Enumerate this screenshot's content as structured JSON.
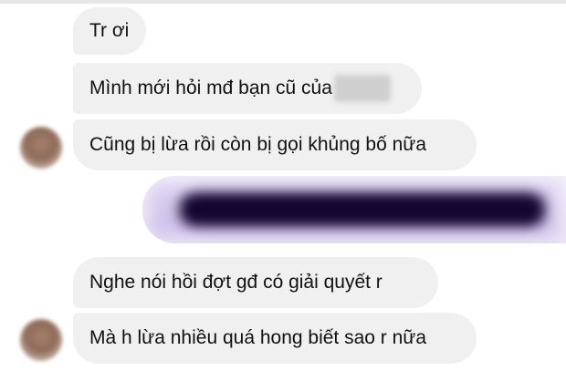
{
  "messages": {
    "received_group_1": [
      {
        "text": "Tr ơi"
      },
      {
        "text": "Mình mới hỏi mđ bạn cũ của"
      },
      {
        "text": "Cũng bị lừa rồi còn bị gọi khủng bố nữa"
      }
    ],
    "received_group_2": [
      {
        "text": "Nghe nói hồi đợt gđ có giải quyết r"
      },
      {
        "text": "Mà h lừa nhiều quá hong biết sao r nữa"
      }
    ]
  },
  "colors": {
    "received_bubble": "#f0f0f0",
    "sent_bubble_tint": "#cbbbe9",
    "text": "#111111"
  }
}
